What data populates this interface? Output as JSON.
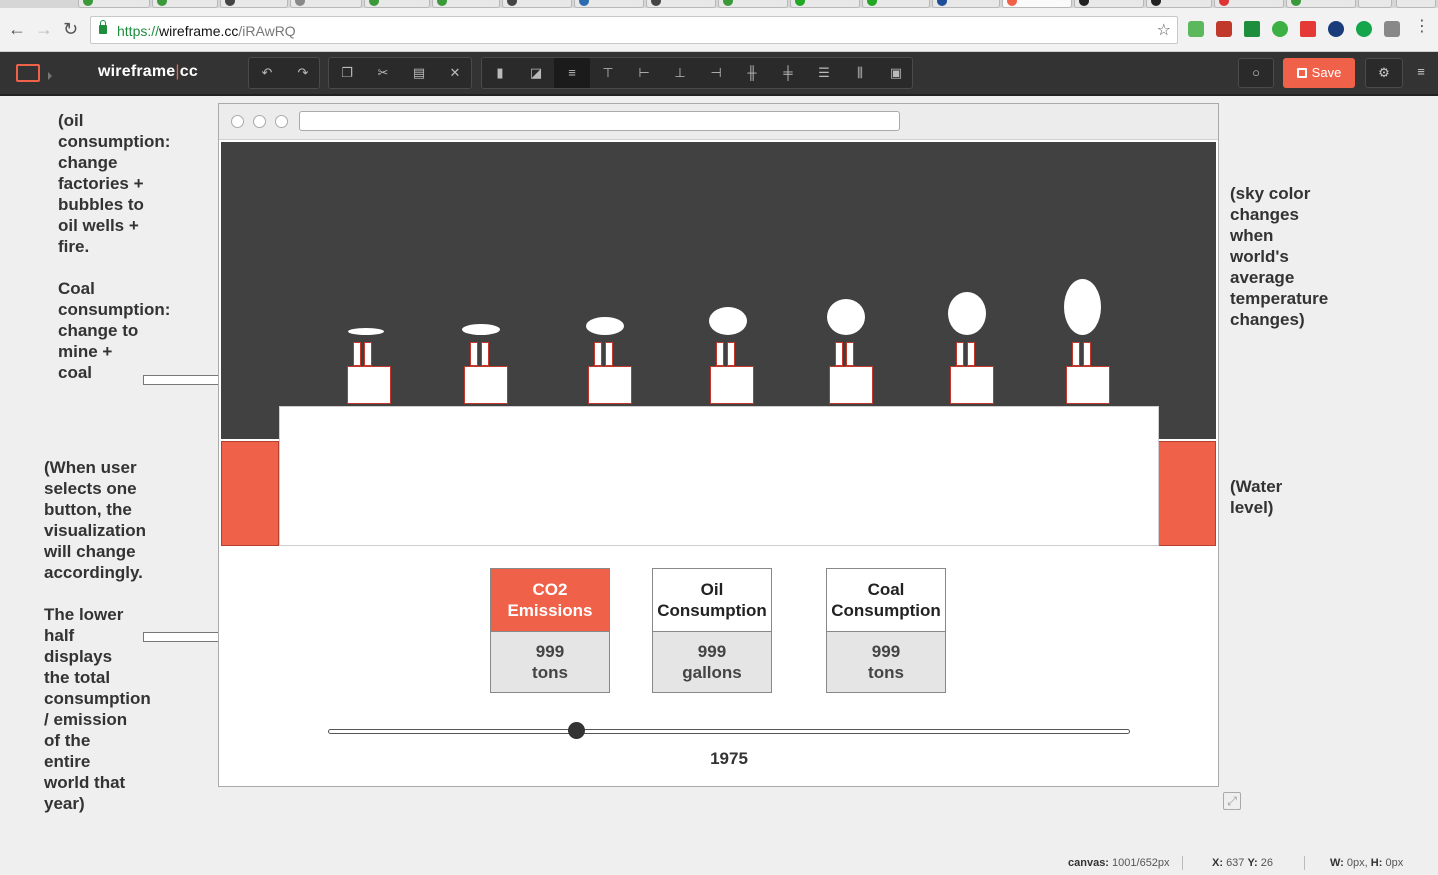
{
  "browser": {
    "url_scheme": "https://",
    "url_host": "wireframe.cc",
    "url_path": "/iRAwRQ"
  },
  "app": {
    "brand_left": "wireframe",
    "brand_sep": "|",
    "brand_right": "cc",
    "save_label": "Save"
  },
  "notes": {
    "oil_coal": "(oil\nconsumption:\nchange\nfactories +\nbubbles to\noil wells +\nfire.\n\nCoal\nconsumption:\nchange to\nmine +\ncoal",
    "selection": "(When user\nselects one\nbutton, the\nvisualization\nwill change\naccordingly.\n\nThe lower\nhalf\ndisplays\nthe total\nconsumption\n/ emission\nof the\nentire\nworld that\nyear)",
    "sky": "(sky color\nchanges\nwhen\nworld's\naverage\ntemperature\nchanges)",
    "water": "(Water\nlevel)"
  },
  "metrics": [
    {
      "title": "CO2\nEmissions",
      "value": "999\ntons",
      "active": true
    },
    {
      "title": "Oil\nConsumption",
      "value": "999\ngallons",
      "active": false
    },
    {
      "title": "Coal\nConsumption",
      "value": "999\ntons",
      "active": false
    }
  ],
  "slider": {
    "year": "1975",
    "position_fraction": 0.31
  },
  "colors": {
    "accent": "#f0614a",
    "sky": "#414141",
    "header": "#333333"
  },
  "status": {
    "canvas_label": "canvas:",
    "canvas_value": "1001/652px",
    "x_label": "X:",
    "x_value": "637",
    "y_label": "Y:",
    "y_value": "26",
    "w_label": "W:",
    "w_value": "0px,",
    "h_label": "H:",
    "h_value": "0px"
  },
  "icons": {
    "undo": "undo-icon",
    "redo": "redo-icon",
    "copy": "copy-icon",
    "cut": "cut-icon",
    "paste": "paste-icon",
    "delete": "delete-icon",
    "lock": "lock-icon",
    "arrange": "arrange-icon"
  }
}
